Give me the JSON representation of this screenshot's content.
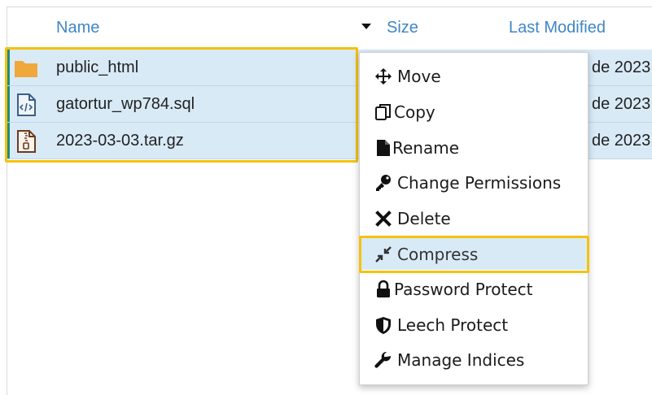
{
  "header": {
    "name_label": "Name",
    "size_label": "Size",
    "modified_label": "Last Modified"
  },
  "files": [
    {
      "name": "public_html",
      "modified": "de 2023",
      "icon": "folder-icon"
    },
    {
      "name": "gatortur_wp784.sql",
      "modified": "de 2023",
      "icon": "code-file-icon"
    },
    {
      "name": "2023-03-03.tar.gz",
      "modified": "de 2023",
      "icon": "archive-file-icon"
    }
  ],
  "context_menu": {
    "items": [
      {
        "label": "Move",
        "icon": "move-arrows-icon"
      },
      {
        "label": "Copy",
        "icon": "copy-icon"
      },
      {
        "label": "Rename",
        "icon": "file-icon"
      },
      {
        "label": "Change Permissions",
        "icon": "key-icon"
      },
      {
        "label": "Delete",
        "icon": "x-icon"
      },
      {
        "label": "Compress",
        "icon": "compress-icon",
        "highlighted": true
      },
      {
        "label": "Password Protect",
        "icon": "lock-icon"
      },
      {
        "label": "Leech Protect",
        "icon": "shield-icon"
      },
      {
        "label": "Manage Indices",
        "icon": "wrench-icon"
      }
    ]
  },
  "colors": {
    "header_text": "#3f86c6",
    "selected_row": "#d9eaf7",
    "highlight_outline": "#f4c20d",
    "folder": "#f0a73c"
  }
}
